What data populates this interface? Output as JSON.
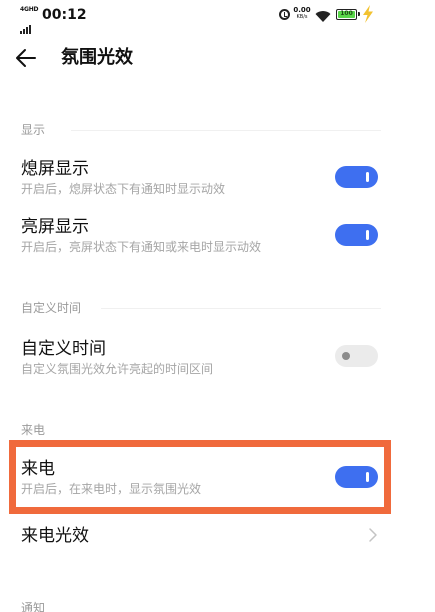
{
  "status_bar": {
    "network": "4GHD",
    "time": "00:12",
    "speed_value": "0.00",
    "speed_unit": "KB/s",
    "battery": "100"
  },
  "header": {
    "title": "氛围光效"
  },
  "sections": {
    "display": {
      "label": "显示",
      "items": [
        {
          "title": "熄屏显示",
          "subtitle": "开启后，熄屏状态下有通知时显示动效",
          "enabled": true
        },
        {
          "title": "亮屏显示",
          "subtitle": "开启后，亮屏状态下有通知或来电时显示动效",
          "enabled": true
        }
      ]
    },
    "custom_time": {
      "label": "自定义时间",
      "items": [
        {
          "title": "自定义时间",
          "subtitle": "自定义氛围光效允许亮起的时间区间",
          "enabled": false
        }
      ]
    },
    "incoming_call": {
      "label": "来电",
      "items": [
        {
          "title": "来电",
          "subtitle": "开启后，在来电时，显示氛围光效",
          "enabled": true
        }
      ],
      "link_label": "来电光效"
    },
    "notification": {
      "label": "通知"
    }
  },
  "colors": {
    "accent": "#3e6ff0",
    "highlight": "#f06a3c",
    "switch_off": "#ebebeb"
  },
  "icons": [
    "back-arrow-icon",
    "alarm-icon",
    "wifi-icon",
    "battery-icon",
    "charging-bolt-icon",
    "chevron-right-icon"
  ]
}
